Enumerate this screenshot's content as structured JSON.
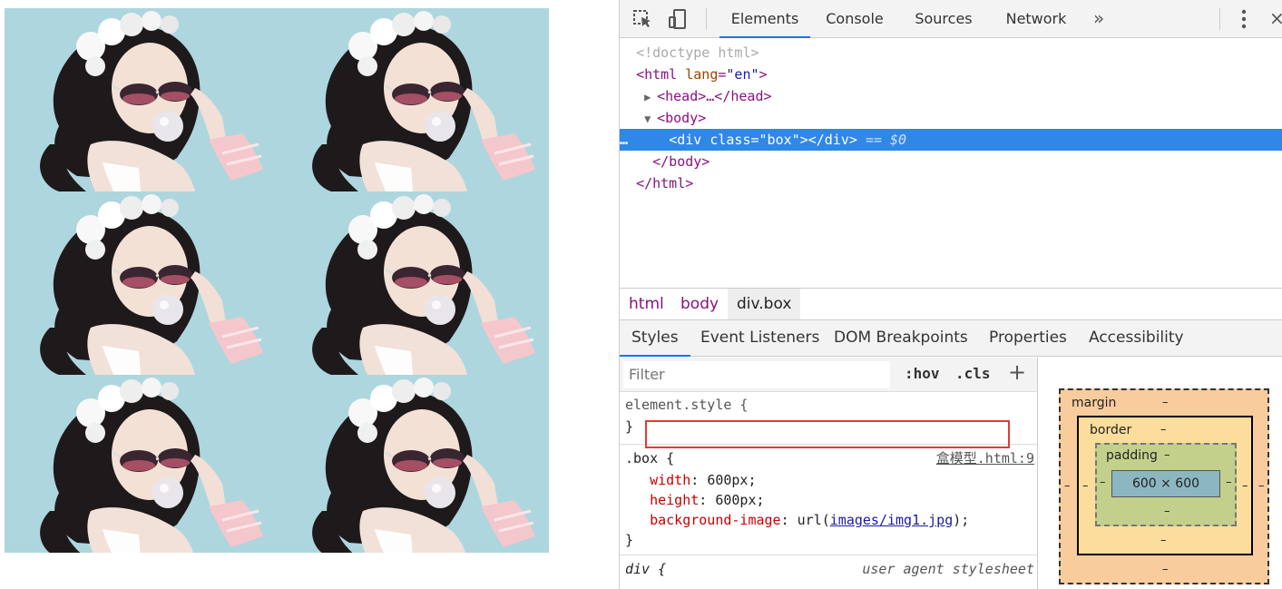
{
  "devtools": {
    "tabs": [
      "Elements",
      "Console",
      "Sources",
      "Network"
    ],
    "active_tab": "Elements",
    "more": "»",
    "close": "×"
  },
  "dom": {
    "doctype": "<!doctype html>",
    "html_open": "html",
    "html_attr": "lang",
    "html_attr_val": "\"en\"",
    "head": "<head>…</head>",
    "body_open": "<body>",
    "div_tag": "<div ",
    "div_attr": "class",
    "div_val": "\"box\"",
    "div_close": "></div>",
    "eq_hint": "== $0",
    "body_close": "</body>",
    "html_close": "</html>",
    "dots": "…"
  },
  "breadcrumbs": [
    "html",
    "body",
    "div.box"
  ],
  "subtabs": [
    "Styles",
    "Event Listeners",
    "DOM Breakpoints",
    "Properties",
    "Accessibility"
  ],
  "styles": {
    "filter_placeholder": "Filter",
    "hov": ":hov",
    "cls": ".cls",
    "plus": "+",
    "element_style": "element.style {",
    "close_brace": "}",
    "box_selector": ".box {",
    "box_source": "盒模型.html:9",
    "props": [
      {
        "name": "width",
        "value": "600px;"
      },
      {
        "name": "height",
        "value": "600px;"
      }
    ],
    "bg_prop": "background-image",
    "bg_url_pre": "url(",
    "bg_url": "images/img1.jpg",
    "bg_url_post": ");",
    "ua_selector": "div {",
    "ua_label": "user agent stylesheet"
  },
  "box_model": {
    "margin": "margin",
    "border": "border",
    "padding": "padding",
    "content": "600 × 600",
    "dash": "–"
  }
}
